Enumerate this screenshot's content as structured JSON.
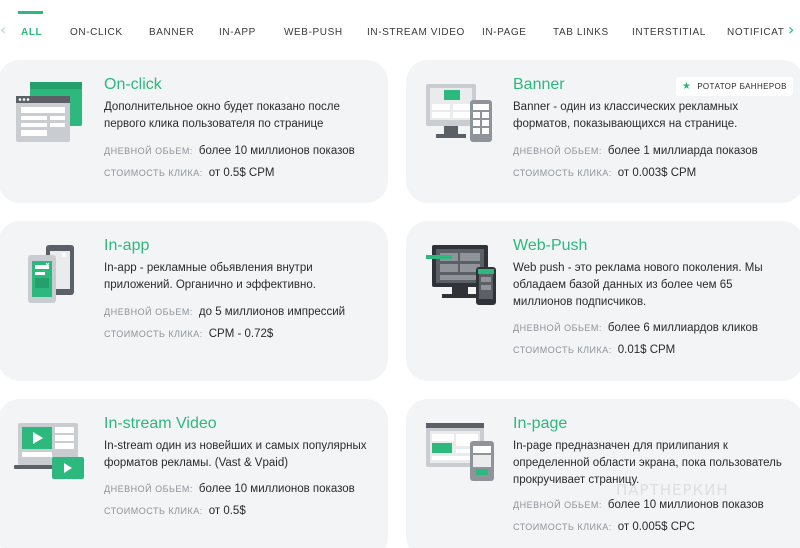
{
  "tabs": [
    {
      "label": "ALL",
      "active": true
    },
    {
      "label": "ON-CLICK"
    },
    {
      "label": "BANNER"
    },
    {
      "label": "IN-APP"
    },
    {
      "label": "WEB-PUSH"
    },
    {
      "label": "IN-STREAM VIDEO"
    },
    {
      "label": "IN-PAGE"
    },
    {
      "label": "TAB LINKS"
    },
    {
      "label": "INTERSTITIAL"
    },
    {
      "label": "NOTIFICAT"
    }
  ],
  "arrows": {
    "left": "‹",
    "right": "›"
  },
  "labels": {
    "volume": "ДНЕВНОЙ ОБЬЕМ:",
    "price": "СТОИМОСТЬ КЛИКА:"
  },
  "cards": [
    {
      "title": "On-click",
      "icon": "popup-window-icon",
      "desc": "Дополнительное окно будет показано после первого клика пользователя по странице",
      "volume": "более 10 миллионов показов",
      "price": "от 0.5$ CPM"
    },
    {
      "title": "Banner",
      "icon": "banner-devices-icon",
      "badge": "РОТАТОР БАННЕРОВ",
      "desc": "Banner - один из классических рекламных форматов, показывающихся на странице.",
      "volume": "более 1 миллиарда показов",
      "price": "от 0.003$ CPM"
    },
    {
      "title": "In-app",
      "icon": "mobile-app-icon",
      "desc": "In-app - рекламные обьявления внутри приложений. Органично и эффективно.",
      "volume": "до 5 миллионов импрессий",
      "price": "CPM - 0.72$"
    },
    {
      "title": "Web-Push",
      "icon": "web-push-devices-icon",
      "desc": "Web push - это реклама нового поколения. Мы обладаем базой данных из более чем 65 миллионов подписчиков.",
      "volume": "более 6 миллиардов кликов",
      "price": "0.01$ CPM"
    },
    {
      "title": "In-stream Video",
      "icon": "video-player-icon",
      "desc": "In-stream один из новейших и самых популярных форматов рекламы. (Vast & Vpaid)",
      "volume": "более 10 миллионов показов",
      "price": "от 0.5$"
    },
    {
      "title": "In-page",
      "icon": "in-page-devices-icon",
      "desc": "In-page предназначен для прилипания к определенной области экрана, пока пользователь прокручивает страницу.",
      "volume": "более 10 миллионов показов",
      "price": "от 0.005$ CPC"
    }
  ],
  "watermark": "ПАРТНЕРКИН",
  "colors": {
    "accent": "#2db87d",
    "card_bg": "#f2f4f6",
    "label": "#8d9399",
    "dark_device": "#2f3338"
  }
}
